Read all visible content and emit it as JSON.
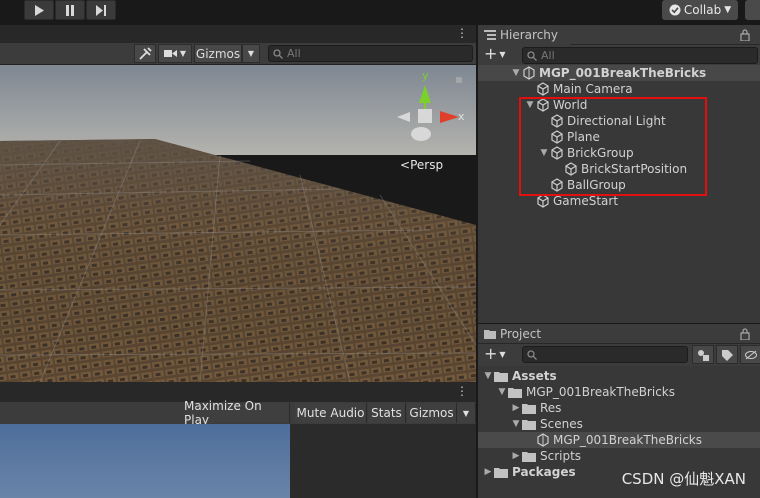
{
  "toolbar": {
    "play_icon": "play-icon",
    "pause_icon": "pause-icon",
    "step_icon": "step-icon",
    "collab_label": "Collab"
  },
  "scene": {
    "gizmos_label": "Gizmos",
    "search_placeholder": "All",
    "persp_label": "Persp",
    "axis_y": "y",
    "axis_x": "x"
  },
  "game": {
    "buttons": [
      "Maximize On Play",
      "Mute Audio",
      "Stats",
      "Gizmos"
    ]
  },
  "hierarchy": {
    "tab_label": "Hierarchy",
    "search_placeholder": "All",
    "scene_name": "MGP_001BreakTheBricks",
    "items": [
      {
        "label": "Main Camera",
        "depth": 1,
        "foldout": false
      },
      {
        "label": "World",
        "depth": 1,
        "foldout": true
      },
      {
        "label": "Directional Light",
        "depth": 2,
        "foldout": false
      },
      {
        "label": "Plane",
        "depth": 2,
        "foldout": false
      },
      {
        "label": "BrickGroup",
        "depth": 2,
        "foldout": true
      },
      {
        "label": "BrickStartPosition",
        "depth": 3,
        "foldout": false
      },
      {
        "label": "BallGroup",
        "depth": 2,
        "foldout": false
      },
      {
        "label": "GameStart",
        "depth": 1,
        "foldout": false
      }
    ],
    "highlight_color": "#e01010"
  },
  "project": {
    "tab_label": "Project",
    "tree": [
      {
        "label": "Assets",
        "bold": true
      },
      {
        "label": "MGP_001BreakTheBricks",
        "bold": false
      },
      {
        "label": "Res",
        "bold": false
      },
      {
        "label": "Scenes",
        "bold": false
      },
      {
        "label": "MGP_001BreakTheBricks",
        "bold": false
      },
      {
        "label": "Scripts",
        "bold": false
      },
      {
        "label": "Packages",
        "bold": true
      }
    ]
  },
  "watermark": "CSDN @仙魁XAN"
}
